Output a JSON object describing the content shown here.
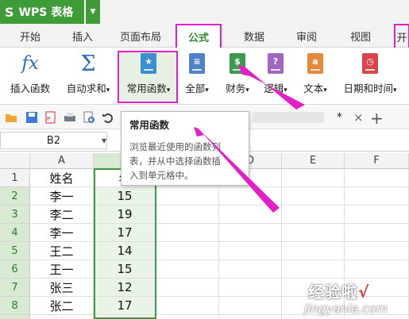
{
  "app": {
    "title": "WPS 表格",
    "logo": "S"
  },
  "tabs": [
    "开始",
    "插入",
    "页面布局",
    "公式",
    "数据",
    "审阅",
    "视图",
    "开"
  ],
  "active_tab": "公式",
  "ribbon": {
    "insert_function": "插入函数",
    "autosum": "自动求和",
    "common_functions": "常用函数",
    "all": "全部",
    "finance": "财务",
    "logic": "逻辑",
    "text": "文本",
    "datetime": "日期和时间",
    "dropdown_glyph": "▾"
  },
  "toolbar": {
    "doc_tab_marker": "*",
    "close": "×",
    "add": "+"
  },
  "formula_bar": {
    "name_box": "B2"
  },
  "tooltip": {
    "title": "常用函数",
    "body_lines": [
      "浏览最近使用的函数列",
      "表，并从中选择函数插",
      "入到单元格中。"
    ]
  },
  "grid": {
    "columns": [
      "A",
      "B",
      "C",
      "D",
      "E",
      "F"
    ],
    "rows": [
      "1",
      "2",
      "3",
      "4",
      "5",
      "6",
      "7",
      "8",
      "9"
    ],
    "col_a": [
      "姓名",
      "李一",
      "李二",
      "李一",
      "王二",
      "王一",
      "张三",
      "张二",
      "张二"
    ],
    "col_b": [
      "年",
      "15",
      "19",
      "17",
      "14",
      "15",
      "12",
      "17",
      "14"
    ]
  },
  "watermark": {
    "line1": "经验啦",
    "check": "√",
    "line2": "jingyanla.com"
  },
  "colors": {
    "accent": "#3f9b38",
    "highlight": "#e51ec9",
    "selection": "#3e9a3e"
  }
}
